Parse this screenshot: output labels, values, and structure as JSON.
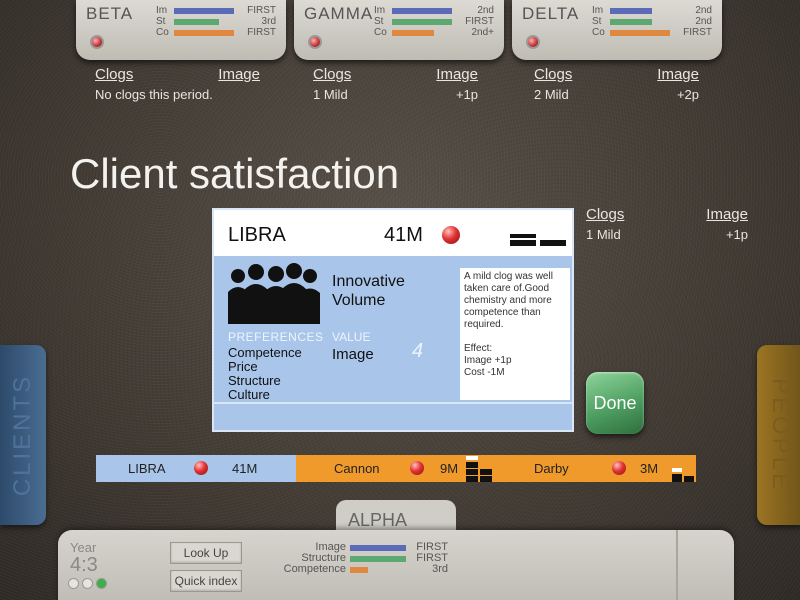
{
  "teams": [
    {
      "name": "BETA",
      "stats": [
        {
          "label": "Im",
          "value": "FIRST",
          "level": 1.0,
          "color": "#5b6bb8"
        },
        {
          "label": "St",
          "value": "3rd",
          "level": 0.75,
          "color": "#5ca870"
        },
        {
          "label": "Co",
          "value": "FIRST",
          "level": 1.0,
          "color": "#e08740"
        }
      ],
      "clogs": {
        "col1": "Clogs",
        "col2": "Image",
        "row_left": "No clogs this period.",
        "row_right": ""
      }
    },
    {
      "name": "GAMMA",
      "stats": [
        {
          "label": "Im",
          "value": "2nd",
          "level": 1.0,
          "color": "#5b6bb8"
        },
        {
          "label": "St",
          "value": "FIRST",
          "level": 1.0,
          "color": "#5ca870"
        },
        {
          "label": "Co",
          "value": "2nd+",
          "level": 0.7,
          "color": "#e08740"
        }
      ],
      "clogs": {
        "col1": "Clogs",
        "col2": "Image",
        "row_left": "1 Mild",
        "row_right": "+1p"
      }
    },
    {
      "name": "DELTA",
      "stats": [
        {
          "label": "Im",
          "value": "2nd",
          "level": 0.7,
          "color": "#5b6bb8"
        },
        {
          "label": "St",
          "value": "2nd",
          "level": 0.7,
          "color": "#5ca870"
        },
        {
          "label": "Co",
          "value": "FIRST",
          "level": 1.0,
          "color": "#e08740"
        }
      ],
      "clogs": {
        "col1": "Clogs",
        "col2": "Image",
        "row_left": "2 Mild",
        "row_right": "+2p"
      }
    }
  ],
  "page_title": "Client satisfaction",
  "client_card": {
    "name": "LIBRA",
    "size": "41M",
    "attributes": [
      "Innovative",
      "Volume"
    ],
    "preferences_label": "PREFERENCES",
    "preferences": [
      "Competence",
      "Price",
      "Structure",
      "Culture"
    ],
    "value_label": "VALUE",
    "value_name": "Image",
    "value_number": "4",
    "note_text": "A mild clog was well taken care of.Good chemistry and more competence than required.",
    "note_effect_label": "Effect:",
    "note_effect_1": "Image +1p",
    "note_effect_2": "Cost -1M"
  },
  "clogs_main": {
    "col1": "Clogs",
    "col2": "Image",
    "row_left": "1 Mild",
    "row_right": "+1p"
  },
  "done_label": "Done",
  "side_tabs": {
    "clients": "CLIENTS",
    "people": "PEOPLE"
  },
  "ranking": [
    {
      "name": "LIBRA",
      "size": "41M",
      "bg": "#a9c6ea"
    },
    {
      "name": "Cannon",
      "size": "9M",
      "bg": "#ef9a2a"
    },
    {
      "name": "Darby",
      "size": "3M",
      "bg": "#ef9a2a"
    }
  ],
  "bottom": {
    "team_name": "ALPHA",
    "year_label": "Year",
    "year_value": "4:3",
    "lookup_label": "Look Up",
    "quick_index_label": "Quick index",
    "stats": [
      {
        "label": "Image",
        "value": "FIRST",
        "level": 1.0,
        "color": "#5b6bb8"
      },
      {
        "label": "Structure",
        "value": "FIRST",
        "level": 1.0,
        "color": "#5ca870"
      },
      {
        "label": "Competence",
        "value": "3rd",
        "level": 0.3,
        "color": "#e08740"
      }
    ],
    "lights": [
      "#e6e4dd",
      "#e6e4dd",
      "#3fae4a"
    ]
  }
}
